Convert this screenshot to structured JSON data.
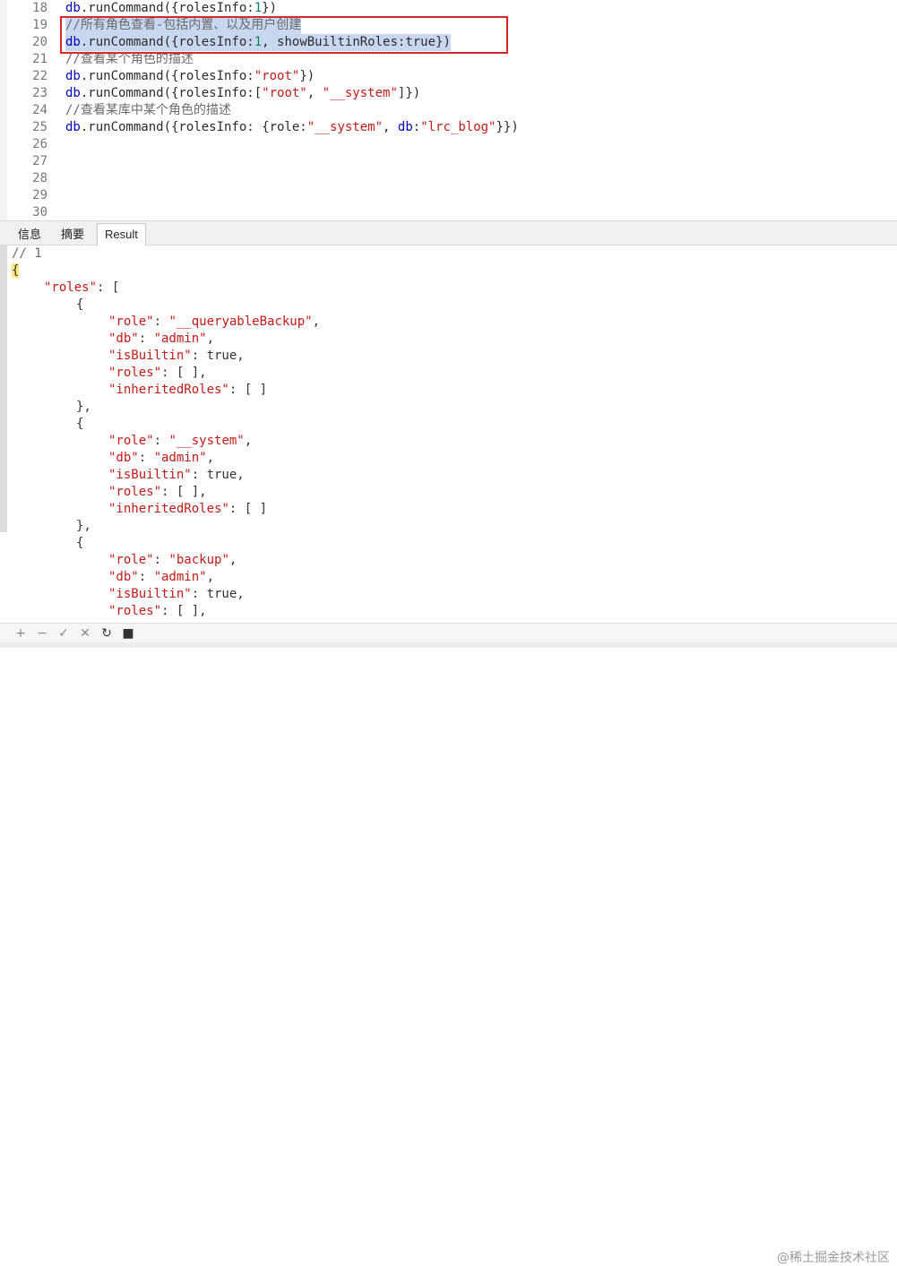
{
  "editor": {
    "lines": [
      {
        "num": "18",
        "segments": [
          [
            "db",
            "kw"
          ],
          [
            ".runCommand({rolesInfo:",
            ""
          ],
          [
            "1",
            "num"
          ],
          [
            "})",
            ""
          ]
        ]
      },
      {
        "num": "19",
        "segments": [
          [
            "//所有角色查看-包括内置、以及用户创建",
            "cmt"
          ]
        ],
        "selected": true
      },
      {
        "num": "20",
        "segments": [
          [
            "db",
            "kw"
          ],
          [
            ".runCommand({rolesInfo:",
            ""
          ],
          [
            "1",
            "num"
          ],
          [
            ", showBuiltinRoles:true})",
            ""
          ]
        ],
        "selected": true
      },
      {
        "num": "21",
        "segments": [
          [
            "//查看某个角色的描述",
            "cmt"
          ]
        ]
      },
      {
        "num": "22",
        "segments": [
          [
            "db",
            "kw"
          ],
          [
            ".runCommand({rolesInfo:",
            ""
          ],
          [
            "\"root\"",
            "str"
          ],
          [
            "})",
            ""
          ]
        ]
      },
      {
        "num": "23",
        "segments": [
          [
            "db",
            "kw"
          ],
          [
            ".runCommand({rolesInfo:[",
            ""
          ],
          [
            "\"root\"",
            "str"
          ],
          [
            ", ",
            ""
          ],
          [
            "\"__system\"",
            "str"
          ],
          [
            "]})",
            ""
          ]
        ]
      },
      {
        "num": "24",
        "segments": [
          [
            "//查看某库中某个角色的描述",
            "cmt"
          ]
        ]
      },
      {
        "num": "25",
        "segments": [
          [
            "db",
            "kw"
          ],
          [
            ".runCommand({rolesInfo: {role:",
            ""
          ],
          [
            "\"__system\"",
            "str"
          ],
          [
            ", ",
            ""
          ],
          [
            "db",
            "kw"
          ],
          [
            ":",
            ""
          ],
          [
            "\"lrc_blog\"",
            "str"
          ],
          [
            "}})",
            ""
          ]
        ]
      },
      {
        "num": "26",
        "segments": []
      },
      {
        "num": "27",
        "segments": []
      },
      {
        "num": "28",
        "segments": []
      },
      {
        "num": "29",
        "segments": []
      },
      {
        "num": "30",
        "segments": []
      }
    ]
  },
  "tabs": [
    {
      "label": "信息",
      "active": false
    },
    {
      "label": "摘要",
      "active": false
    },
    {
      "label": "Result",
      "active": true
    }
  ],
  "result": {
    "lines": [
      {
        "indent": 0,
        "segments": [
          [
            "// 1",
            "cmt"
          ]
        ]
      },
      {
        "indent": 0,
        "segments": [
          [
            "{",
            "brace"
          ]
        ]
      },
      {
        "indent": 1,
        "segments": [
          [
            "\"roles\"",
            "key"
          ],
          [
            ": [",
            "p"
          ]
        ]
      },
      {
        "indent": 2,
        "segments": [
          [
            "{",
            "p"
          ]
        ]
      },
      {
        "indent": 3,
        "segments": [
          [
            "\"role\"",
            "key"
          ],
          [
            ": ",
            "p"
          ],
          [
            "\"__queryableBackup\"",
            "str"
          ],
          [
            ",",
            "p"
          ]
        ]
      },
      {
        "indent": 3,
        "segments": [
          [
            "\"db\"",
            "key"
          ],
          [
            ": ",
            "p"
          ],
          [
            "\"admin\"",
            "str"
          ],
          [
            ",",
            "p"
          ]
        ]
      },
      {
        "indent": 3,
        "segments": [
          [
            "\"isBuiltin\"",
            "key"
          ],
          [
            ": true,",
            "p"
          ]
        ]
      },
      {
        "indent": 3,
        "segments": [
          [
            "\"roles\"",
            "key"
          ],
          [
            ": [ ],",
            "p"
          ]
        ]
      },
      {
        "indent": 3,
        "segments": [
          [
            "\"inheritedRoles\"",
            "key"
          ],
          [
            ": [ ]",
            "p"
          ]
        ]
      },
      {
        "indent": 2,
        "segments": [
          [
            "},",
            "p"
          ]
        ]
      },
      {
        "indent": 2,
        "segments": [
          [
            "{",
            "p"
          ]
        ]
      },
      {
        "indent": 3,
        "segments": [
          [
            "\"role\"",
            "key"
          ],
          [
            ": ",
            "p"
          ],
          [
            "\"__system\"",
            "str"
          ],
          [
            ",",
            "p"
          ]
        ]
      },
      {
        "indent": 3,
        "segments": [
          [
            "\"db\"",
            "key"
          ],
          [
            ": ",
            "p"
          ],
          [
            "\"admin\"",
            "str"
          ],
          [
            ",",
            "p"
          ]
        ]
      },
      {
        "indent": 3,
        "segments": [
          [
            "\"isBuiltin\"",
            "key"
          ],
          [
            ": true,",
            "p"
          ]
        ]
      },
      {
        "indent": 3,
        "segments": [
          [
            "\"roles\"",
            "key"
          ],
          [
            ": [ ],",
            "p"
          ]
        ]
      },
      {
        "indent": 3,
        "segments": [
          [
            "\"inheritedRoles\"",
            "key"
          ],
          [
            ": [ ]",
            "p"
          ]
        ]
      },
      {
        "indent": 2,
        "segments": [
          [
            "},",
            "p"
          ]
        ]
      },
      {
        "indent": 2,
        "segments": [
          [
            "{",
            "p"
          ]
        ]
      },
      {
        "indent": 3,
        "segments": [
          [
            "\"role\"",
            "key"
          ],
          [
            ": ",
            "p"
          ],
          [
            "\"backup\"",
            "str"
          ],
          [
            ",",
            "p"
          ]
        ]
      },
      {
        "indent": 3,
        "segments": [
          [
            "\"db\"",
            "key"
          ],
          [
            ": ",
            "p"
          ],
          [
            "\"admin\"",
            "str"
          ],
          [
            ",",
            "p"
          ]
        ]
      },
      {
        "indent": 3,
        "segments": [
          [
            "\"isBuiltin\"",
            "key"
          ],
          [
            ": true,",
            "p"
          ]
        ]
      },
      {
        "indent": 3,
        "segments": [
          [
            "\"roles\"",
            "key"
          ],
          [
            ": [ ],",
            "p"
          ]
        ]
      }
    ]
  },
  "toolbar": {
    "buttons": [
      {
        "name": "add-icon",
        "glyph": "+"
      },
      {
        "name": "remove-icon",
        "glyph": "−"
      },
      {
        "name": "apply-icon",
        "glyph": "✓"
      },
      {
        "name": "discard-icon",
        "glyph": "✕"
      },
      {
        "name": "refresh-icon",
        "glyph": "↻"
      },
      {
        "name": "stop-icon",
        "glyph": "■"
      }
    ]
  },
  "watermark": "@稀土掘金技术社区",
  "colors": {
    "selection": "#c8d7f0",
    "box": "#d62a2a",
    "keyword": "#0000c0",
    "string": "#c41a16",
    "number": "#098658"
  }
}
